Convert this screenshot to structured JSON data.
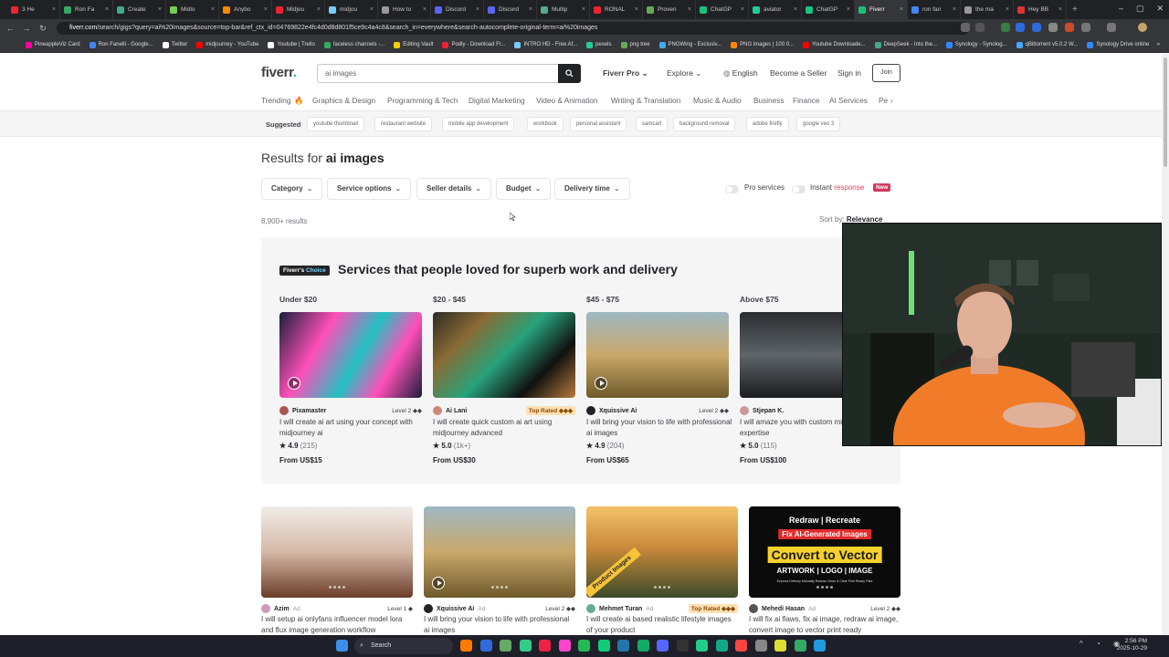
{
  "browser": {
    "tabs": [
      "3 He",
      "Ron Fa",
      "Create",
      "Midlo",
      "Anybo",
      "Midjou",
      "midjou",
      "How to",
      "Discord",
      "Discord",
      "Multip",
      "RONAL",
      "Proven",
      "ChatGP",
      "aviator",
      "ChatGP",
      "Fiverr",
      "ron fan",
      "the ma",
      "Hey BB"
    ],
    "active_tab_index": 16,
    "url_host": "fiverr.com",
    "url_path": "/search/gigs?query=ai%20images&source=top-bar&ref_ctx_id=04769822e4fc4d0d8d801f5ce9c4a4c8&search_in=everywhere&search-autocomplete-original-term=ai%20images",
    "bookmarks": [
      "PineappleViz Card",
      "Ron Fanelli - Google...",
      "Twitter",
      "midjourney - YouTube",
      "Youtube | Trello",
      "faceless channels -...",
      "Editing Vault",
      "Podly - Download Fr...",
      "INTRO HD - Free Af...",
      "pexels",
      "png tree",
      "PNGWing - Exclusiv...",
      "PNG images | 100 0...",
      "Youtube Downloade...",
      "DeepSeek - Into the...",
      "Synology - Synolog...",
      "qBittorrent v5.0.2 W...",
      "Synology Drive online"
    ]
  },
  "header": {
    "logo": "fiverr",
    "logo_dot": ".",
    "search_value": "ai images",
    "nav": [
      "Fiverr Pro",
      "Explore",
      "English",
      "Become a Seller",
      "Sign in"
    ],
    "join": "Join"
  },
  "categories": [
    "Trending",
    "Graphics & Design",
    "Programming & Tech",
    "Digital Marketing",
    "Video & Animation",
    "Writing & Translation",
    "Music & Audio",
    "Business",
    "Finance",
    "AI Services",
    "Pe"
  ],
  "suggested": {
    "label": "Suggested",
    "chips": [
      "youtube thumbnail",
      "restaurant website",
      "mobile app development",
      "workbook",
      "personal assistant",
      "samcart",
      "background removal",
      "adobe firefly",
      "google veo 3"
    ]
  },
  "results": {
    "prefix": "Results for",
    "query": "ai images",
    "filters": [
      "Category",
      "Service options",
      "Seller details",
      "Budget",
      "Delivery time"
    ],
    "pro_services": "Pro services",
    "instant_a": "Instant",
    "instant_b": "response",
    "new_badge": "New",
    "count": "8,900+ results",
    "sort_label": "Sort by:",
    "sort_value": "Relevance"
  },
  "choice": {
    "badge_a": "Fiverr's",
    "badge_b": "Choice",
    "title": "Services that people loved for superb work and delivery",
    "cards": [
      {
        "range": "Under $20",
        "seller": "Pixamaster",
        "level": "Level 2 ◆◆",
        "text": "I will create ai art using your concept with midjourney ai",
        "rating": "4.9",
        "reviews": "(215)",
        "price": "From US$15"
      },
      {
        "range": "$20 - $45",
        "seller": "Ai Lani",
        "level": "Top Rated ◆◆◆",
        "text": "I will create quick custom ai art using midjourney advanced",
        "rating": "5.0",
        "reviews": "(1k+)",
        "price": "From US$30"
      },
      {
        "range": "$45 - $75",
        "seller": "Xquissive Ai",
        "level": "Level 2 ◆◆",
        "text": "I will bring your vision to life with professional ai images",
        "rating": "4.9",
        "reviews": "(204)",
        "price": "From US$65"
      },
      {
        "range": "Above $75",
        "seller": "Stjepan K.",
        "level": "",
        "text": "I will amaze you with custom midjourney ai expertise",
        "rating": "5.0",
        "reviews": "(115)",
        "price": "From US$100"
      }
    ]
  },
  "grid": [
    {
      "seller": "Azim",
      "ad": "Ad",
      "level": "Level 1 ◆",
      "text": "I will setup ai onlyfans influencer model lora and flux image generation workflow"
    },
    {
      "seller": "Xquissive Ai",
      "ad": "Ad",
      "level": "Level 2 ◆◆",
      "text": "I will bring your vision to life with professional ai images"
    },
    {
      "seller": "Mehmet Turan",
      "ad": "Ad",
      "level": "Top Rated ◆◆◆",
      "text": "I will create ai based realistic lifestyle images of your product",
      "img_label": "Product Images"
    },
    {
      "seller": "Mehedi Hasan",
      "ad": "Ad",
      "level": "Level 2 ◆◆",
      "text": "I will fix ai flaws, fix ai image, redraw ai image, convert image to vector print ready",
      "img_lines": [
        "Redraw | Recreate",
        "Fix AI-Generated Images",
        "Convert to Vector",
        "ARTWORK | LOGO | IMAGE",
        "Express Delivery   Manually Redraw   Clean & Clear   Print Ready Files"
      ]
    }
  ],
  "taskbar": {
    "search": "Search",
    "time": "2:56 PM",
    "date": "2025-10-29"
  }
}
